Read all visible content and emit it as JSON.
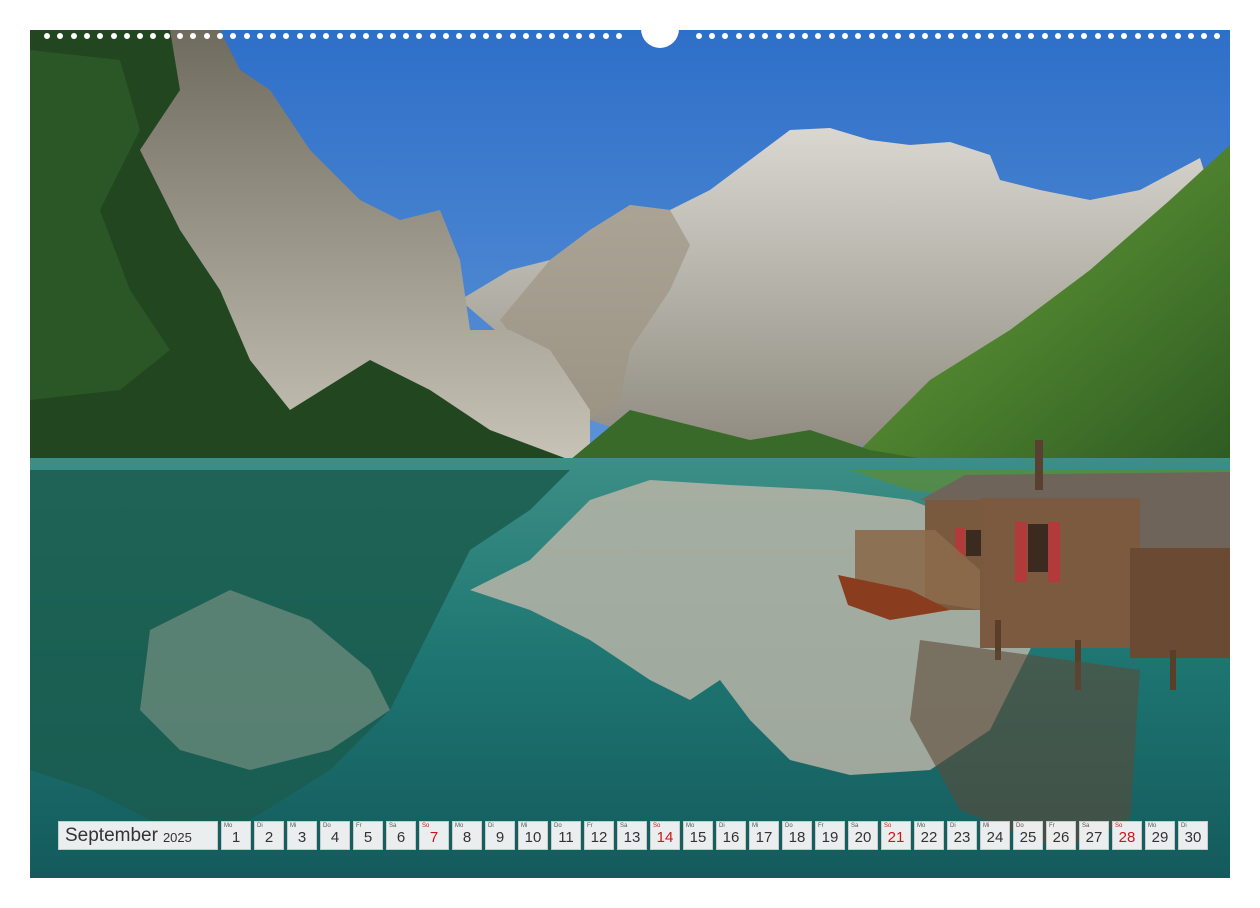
{
  "calendar": {
    "month": "September",
    "year": "2025",
    "days": [
      {
        "wd": "Mo",
        "num": "1",
        "sunday": false
      },
      {
        "wd": "Di",
        "num": "2",
        "sunday": false
      },
      {
        "wd": "Mi",
        "num": "3",
        "sunday": false
      },
      {
        "wd": "Do",
        "num": "4",
        "sunday": false
      },
      {
        "wd": "Fr",
        "num": "5",
        "sunday": false
      },
      {
        "wd": "Sa",
        "num": "6",
        "sunday": false
      },
      {
        "wd": "So",
        "num": "7",
        "sunday": true
      },
      {
        "wd": "Mo",
        "num": "8",
        "sunday": false
      },
      {
        "wd": "Di",
        "num": "9",
        "sunday": false
      },
      {
        "wd": "Mi",
        "num": "10",
        "sunday": false
      },
      {
        "wd": "Do",
        "num": "11",
        "sunday": false
      },
      {
        "wd": "Fr",
        "num": "12",
        "sunday": false
      },
      {
        "wd": "Sa",
        "num": "13",
        "sunday": false
      },
      {
        "wd": "So",
        "num": "14",
        "sunday": true
      },
      {
        "wd": "Mo",
        "num": "15",
        "sunday": false
      },
      {
        "wd": "Di",
        "num": "16",
        "sunday": false
      },
      {
        "wd": "Mi",
        "num": "17",
        "sunday": false
      },
      {
        "wd": "Do",
        "num": "18",
        "sunday": false
      },
      {
        "wd": "Fr",
        "num": "19",
        "sunday": false
      },
      {
        "wd": "Sa",
        "num": "20",
        "sunday": false
      },
      {
        "wd": "So",
        "num": "21",
        "sunday": true
      },
      {
        "wd": "Mo",
        "num": "22",
        "sunday": false
      },
      {
        "wd": "Di",
        "num": "23",
        "sunday": false
      },
      {
        "wd": "Mi",
        "num": "24",
        "sunday": false
      },
      {
        "wd": "Do",
        "num": "25",
        "sunday": false
      },
      {
        "wd": "Fr",
        "num": "26",
        "sunday": false
      },
      {
        "wd": "Sa",
        "num": "27",
        "sunday": false
      },
      {
        "wd": "So",
        "num": "28",
        "sunday": true
      },
      {
        "wd": "Mo",
        "num": "29",
        "sunday": false
      },
      {
        "wd": "Di",
        "num": "30",
        "sunday": false
      }
    ]
  },
  "colors": {
    "sunday_red": "#d0131b",
    "sky": "#3f7fcf",
    "lake": "#1f7f7a",
    "forest": "#2f5a2a"
  }
}
